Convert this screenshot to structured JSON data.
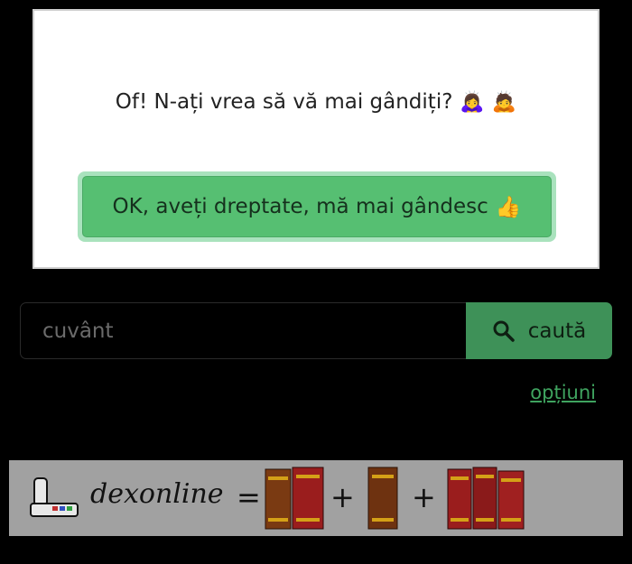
{
  "dialog": {
    "message": "Of! N-ați vrea să vă mai gândiți?",
    "emoji_1": "🙇‍♀️",
    "emoji_2": "🙇",
    "ok_button_label": "OK, aveți dreptate, mă mai gândesc",
    "ok_button_emoji": "👍"
  },
  "search": {
    "placeholder": "cuvânt",
    "button_label": "caută",
    "icon": "search-icon"
  },
  "options_link": "opțiuni",
  "banner": {
    "logo_text": "dexonline",
    "equals": "=",
    "plus": "+"
  },
  "colors": {
    "background": "#000000",
    "primary_green": "#56bf72",
    "search_button_green": "#3e9158",
    "link_green": "#3fa35f"
  }
}
